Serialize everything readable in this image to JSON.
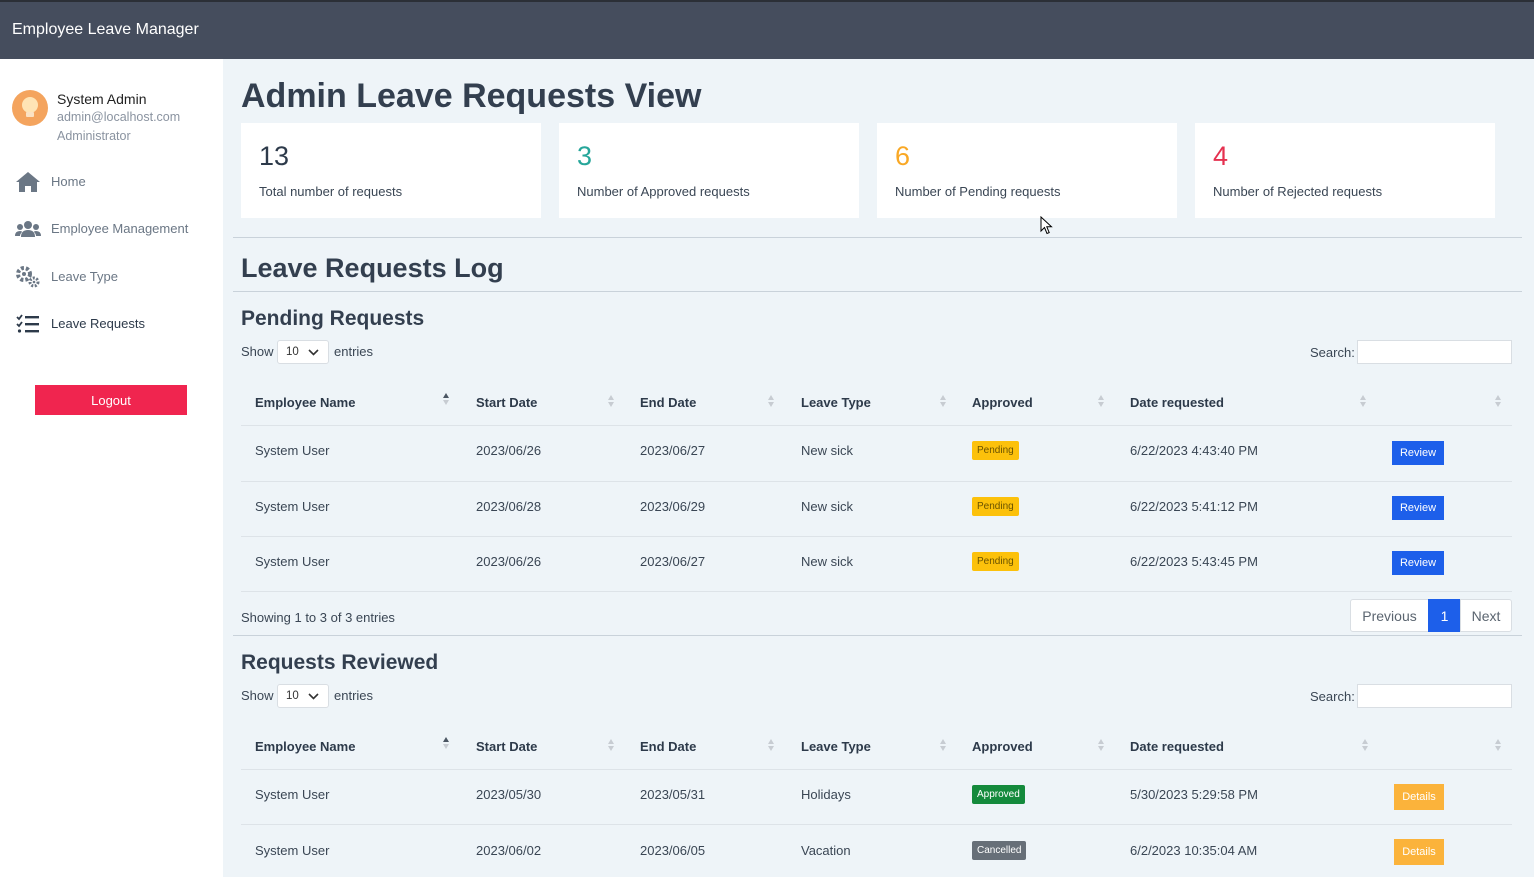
{
  "app": {
    "title": "Employee Leave Manager"
  },
  "user": {
    "name": "System Admin",
    "email": "admin@localhost.com",
    "role": "Administrator"
  },
  "nav": [
    {
      "label": "Home",
      "icon": "home-icon"
    },
    {
      "label": "Employee Management",
      "icon": "users-icon"
    },
    {
      "label": "Leave Type",
      "icon": "cogs-icon"
    },
    {
      "label": "Leave Requests",
      "icon": "tasks-icon"
    }
  ],
  "logout_label": "Logout",
  "page_title": "Admin Leave Requests View",
  "stats": [
    {
      "value": "13",
      "label": "Total number of requests",
      "color": "#2d3a4a"
    },
    {
      "value": "3",
      "label": "Number of Approved requests",
      "color": "#26a69a"
    },
    {
      "value": "6",
      "label": "Number of Pending requests",
      "color": "#f9a825"
    },
    {
      "value": "4",
      "label": "Number of Rejected requests",
      "color": "#e53150"
    }
  ],
  "log_title": "Leave Requests Log",
  "columns": [
    "Employee Name",
    "Start Date",
    "End Date",
    "Leave Type",
    "Approved",
    "Date requested"
  ],
  "pending": {
    "title": "Pending Requests",
    "show_label": "Show",
    "page_size": "10",
    "entries_label": "entries",
    "search_label": "Search:",
    "rows": [
      {
        "employee": "System User",
        "start": "2023/06/26",
        "end": "2023/06/27",
        "type": "New sick",
        "status": "Pending",
        "requested": "6/22/2023 4:43:40 PM",
        "action": "Review"
      },
      {
        "employee": "System User",
        "start": "2023/06/28",
        "end": "2023/06/29",
        "type": "New sick",
        "status": "Pending",
        "requested": "6/22/2023 5:41:12 PM",
        "action": "Review"
      },
      {
        "employee": "System User",
        "start": "2023/06/26",
        "end": "2023/06/27",
        "type": "New sick",
        "status": "Pending",
        "requested": "6/22/2023 5:43:45 PM",
        "action": "Review"
      }
    ],
    "info": "Showing 1 to 3 of 3 entries",
    "pager": {
      "previous": "Previous",
      "current": "1",
      "next": "Next"
    }
  },
  "reviewed": {
    "title": "Requests Reviewed",
    "show_label": "Show",
    "page_size": "10",
    "entries_label": "entries",
    "search_label": "Search:",
    "rows": [
      {
        "employee": "System User",
        "start": "2023/05/30",
        "end": "2023/05/31",
        "type": "Holidays",
        "status": "Approved",
        "requested": "5/30/2023 5:29:58 PM",
        "action": "Details"
      },
      {
        "employee": "System User",
        "start": "2023/06/02",
        "end": "2023/06/05",
        "type": "Vacation",
        "status": "Cancelled",
        "requested": "6/2/2023 10:35:04 AM",
        "action": "Details"
      }
    ]
  }
}
